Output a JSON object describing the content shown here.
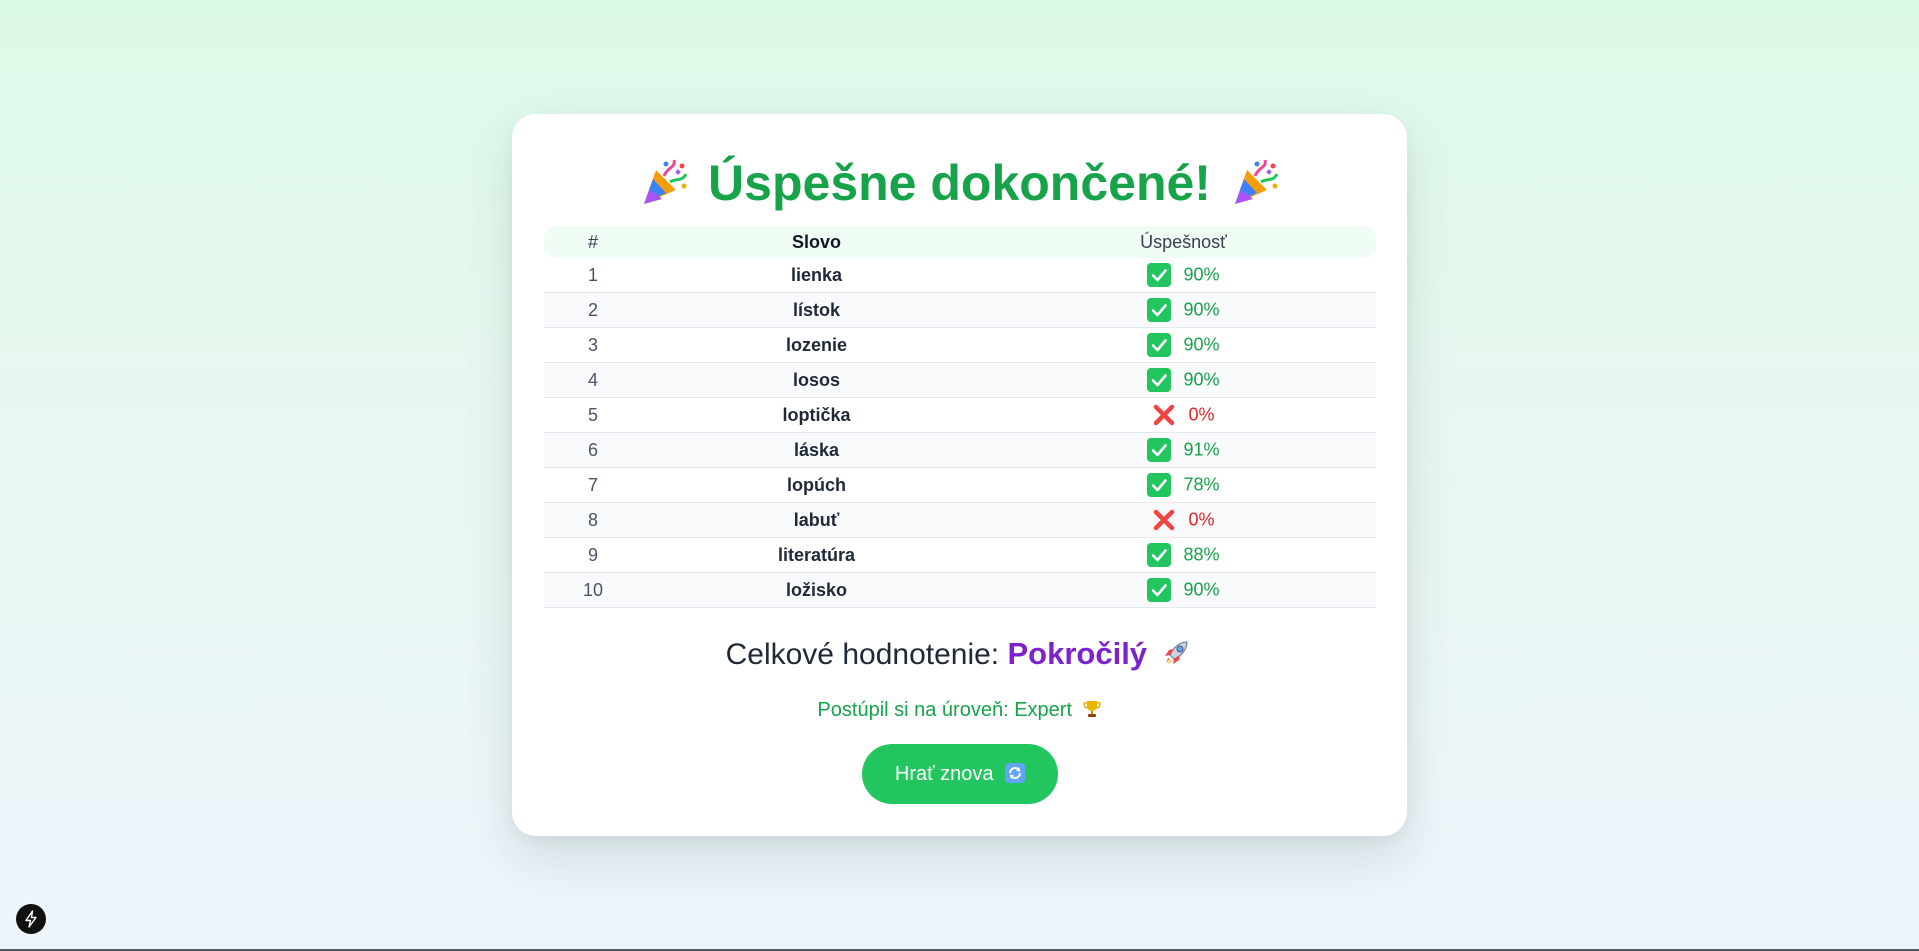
{
  "header": {
    "title": "Úspešne dokončené!",
    "left_icon": "party-popper-icon",
    "right_icon": "party-popper-icon"
  },
  "table": {
    "columns": [
      "#",
      "Slovo",
      "Úspešnosť"
    ],
    "rows": [
      {
        "num": "1",
        "word": "lienka",
        "status": "success",
        "icon": "check-mark-icon",
        "score": "90%"
      },
      {
        "num": "2",
        "word": "lístok",
        "status": "success",
        "icon": "check-mark-icon",
        "score": "90%"
      },
      {
        "num": "3",
        "word": "lozenie",
        "status": "success",
        "icon": "check-mark-icon",
        "score": "90%"
      },
      {
        "num": "4",
        "word": "losos",
        "status": "success",
        "icon": "check-mark-icon",
        "score": "90%"
      },
      {
        "num": "5",
        "word": "loptička",
        "status": "fail",
        "icon": "cross-mark-icon",
        "score": "0%"
      },
      {
        "num": "6",
        "word": "láska",
        "status": "success",
        "icon": "check-mark-icon",
        "score": "91%"
      },
      {
        "num": "7",
        "word": "lopúch",
        "status": "success",
        "icon": "check-mark-icon",
        "score": "78%"
      },
      {
        "num": "8",
        "word": "labuť",
        "status": "fail",
        "icon": "cross-mark-icon",
        "score": "0%"
      },
      {
        "num": "9",
        "word": "literatúra",
        "status": "success",
        "icon": "check-mark-icon",
        "score": "88%"
      },
      {
        "num": "10",
        "word": "ložisko",
        "status": "success",
        "icon": "check-mark-icon",
        "score": "90%"
      }
    ]
  },
  "summary": {
    "label": "Celkové hodnotenie:",
    "level": "Pokročilý",
    "level_icon": "rocket-icon",
    "promotion": "Postúpil si na úroveň: Expert",
    "promotion_icon": "trophy-icon"
  },
  "actions": {
    "play_again_label": "Hrať znova",
    "play_again_icon": "refresh-icon"
  },
  "dev_indicator": {
    "icon": "lightning-icon"
  },
  "colors": {
    "success": "#16a34a",
    "fail": "#dc2626",
    "level": "#7e22ce",
    "button": "#22c55e"
  }
}
